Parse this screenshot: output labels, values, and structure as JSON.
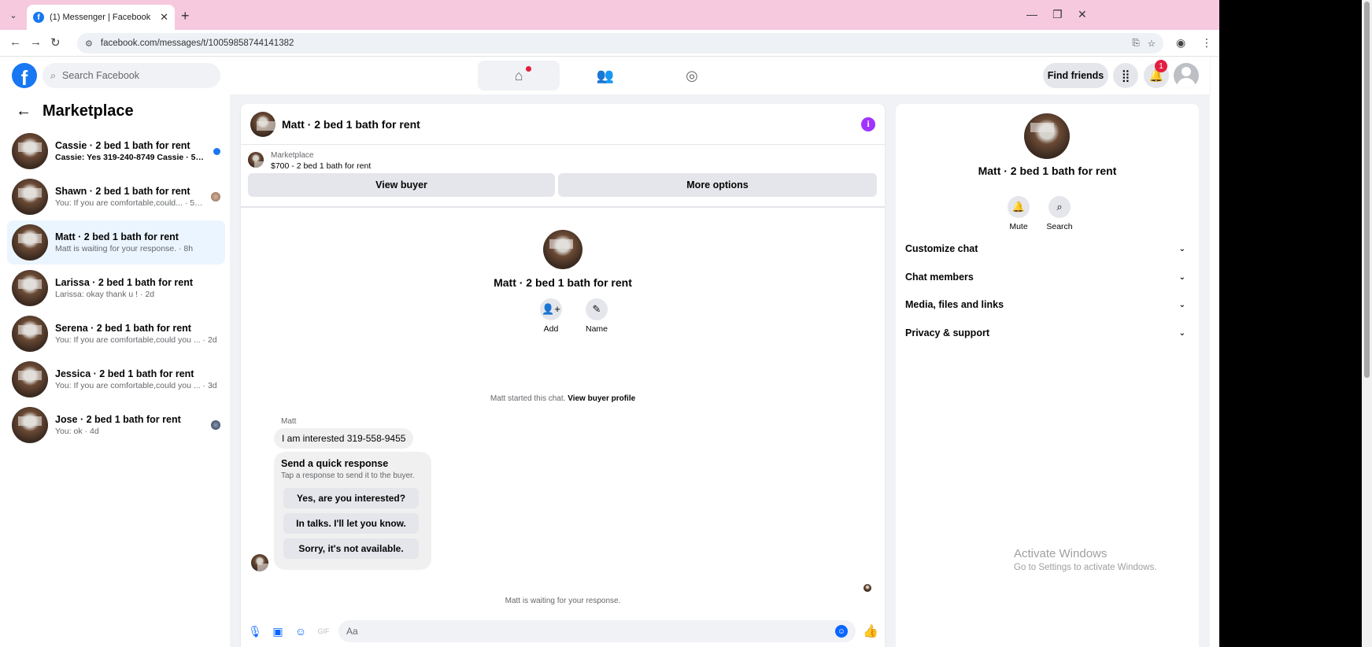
{
  "browser": {
    "tab_title": "(1) Messenger | Facebook",
    "url": "facebook.com/messages/t/10059858744141382"
  },
  "header": {
    "search_placeholder": "Search Facebook",
    "find_friends": "Find friends",
    "notification_count": "1"
  },
  "sidebar": {
    "title": "Marketplace",
    "conversations": [
      {
        "name": "Cassie · 2 bed 1 bath for rent",
        "preview": "Cassie: Yes 319-240-8749 Cassie · 57m",
        "unread": true,
        "selected": false
      },
      {
        "name": "Shawn · 2 bed 1 bath for rent",
        "preview": "You: If you are comfortable,could... · 58m",
        "unread": false,
        "selected": false
      },
      {
        "name": "Matt · 2 bed 1 bath for rent",
        "preview": "Matt is waiting for your response. · 8h",
        "unread": false,
        "selected": true
      },
      {
        "name": "Larissa · 2 bed 1 bath for rent",
        "preview": "Larissa: okay thank u ! · 2d",
        "unread": false,
        "selected": false
      },
      {
        "name": "Serena · 2 bed 1 bath for rent",
        "preview": "You: If you are comfortable,could you ... · 2d",
        "unread": false,
        "selected": false
      },
      {
        "name": "Jessica · 2 bed 1 bath for rent",
        "preview": "You: If you are comfortable,could you ... · 3d",
        "unread": false,
        "selected": false
      },
      {
        "name": "Jose · 2 bed 1 bath for rent",
        "preview": "You: ok · 4d",
        "unread": false,
        "selected": false
      }
    ]
  },
  "chat": {
    "title": "Matt · 2 bed 1 bath for rent",
    "listing_source": "Marketplace",
    "listing_line": "$700 - 2 bed 1 bath for rent",
    "view_buyer": "View buyer",
    "more_options": "More options",
    "intro_name": "Matt · 2 bed 1 bath for rent",
    "add_label": "Add",
    "name_label": "Name",
    "started_text": "Matt started this chat.",
    "view_buyer_profile": "View buyer profile",
    "sender": "Matt",
    "message": "I am interested 319-558-9455",
    "quick_title": "Send a quick response",
    "quick_sub": "Tap a response to send it to the buyer.",
    "quick_replies": [
      "Yes, are you interested?",
      "In talks. I'll let you know.",
      "Sorry, it's not available."
    ],
    "waiting": "Matt is waiting for your response.",
    "composer_placeholder": "Aa"
  },
  "details": {
    "name": "Matt · 2 bed 1 bath for rent",
    "mute": "Mute",
    "search": "Search",
    "sections": [
      "Customize chat",
      "Chat members",
      "Media, files and links",
      "Privacy & support"
    ]
  },
  "watermark": {
    "line1": "Activate Windows",
    "line2": "Go to Settings to activate Windows."
  },
  "colors": {
    "brand": "#1877f2",
    "accent": "#0866ff",
    "info": "#a033ff",
    "tabstrip": "#f6c9df"
  }
}
